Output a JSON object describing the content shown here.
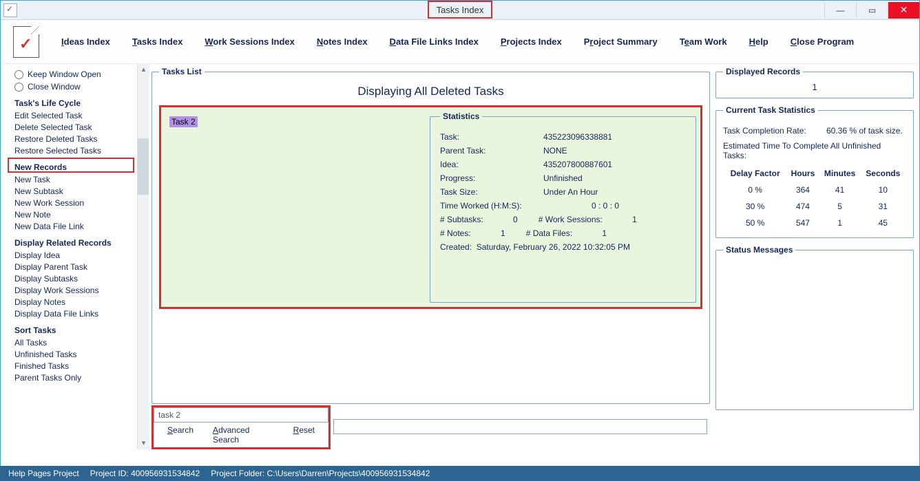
{
  "window": {
    "title": "Tasks Index"
  },
  "menu": {
    "ideas": "Ideas Index",
    "tasks": "Tasks Index",
    "work_sessions": "Work Sessions Index",
    "notes": "Notes Index",
    "data_links": "Data File Links Index",
    "projects": "Projects Index",
    "project_summary": "Project Summary",
    "team": "Team Work",
    "help": "Help",
    "close": "Close Program"
  },
  "sidebar": {
    "keep_open": "Keep Window Open",
    "close_window": "Close Window",
    "life_head": "Task's Life Cycle",
    "life": [
      "Edit Selected Task",
      "Delete Selected Task",
      "Restore Deleted Tasks",
      "Restore Selected Tasks"
    ],
    "new_head": "New Records",
    "new_items": [
      "New Task",
      "New Subtask",
      "New Work Session",
      "New Note",
      "New Data File Link"
    ],
    "disp_head": "Display Related Records",
    "disp_items": [
      "Display Idea",
      "Display Parent Task",
      "Display Subtasks",
      "Display Work Sessions",
      "Display Notes",
      "Display Data File Links"
    ],
    "sort_head": "Sort Tasks",
    "sort_items": [
      "All Tasks",
      "Unfinished Tasks",
      "Finished Tasks",
      "Parent Tasks Only"
    ]
  },
  "tasks_list": {
    "legend": "Tasks List",
    "title": "Displaying All Deleted Tasks",
    "selected": "Task 2",
    "stats_legend": "Statistics",
    "stats": {
      "task_lbl": "Task:",
      "task_val": "435223096338881",
      "parent_lbl": "Parent Task:",
      "parent_val": "NONE",
      "idea_lbl": "Idea:",
      "idea_val": "435207800887601",
      "progress_lbl": "Progress:",
      "progress_val": "Unfinished",
      "size_lbl": "Task Size:",
      "size_val": "Under An Hour",
      "time_lbl": "Time Worked (H:M:S):",
      "time_val": "0  :  0  :  0",
      "sub_lbl": "# Subtasks:",
      "sub_val": "0",
      "ws_lbl": "# Work Sessions:",
      "ws_val": "1",
      "notes_lbl": "# Notes:",
      "notes_val": "1",
      "df_lbl": "# Data Files:",
      "df_val": "1",
      "created_lbl": "Created:",
      "created_val": "Saturday, February 26, 2022   10:32:05 PM"
    }
  },
  "displayed": {
    "legend": "Displayed Records",
    "count": "1"
  },
  "cts": {
    "legend": "Current Task Statistics",
    "rate_lbl": "Task Completion Rate:",
    "rate_val": "60.36 % of task size.",
    "est_lbl": "Estimated Time To Complete All Unfinished Tasks:",
    "head": {
      "delay": "Delay Factor",
      "hours": "Hours",
      "min": "Minutes",
      "sec": "Seconds"
    },
    "rows": [
      {
        "d": "0 %",
        "h": "364",
        "m": "41",
        "s": "10"
      },
      {
        "d": "30 %",
        "h": "474",
        "m": "5",
        "s": "31"
      },
      {
        "d": "50 %",
        "h": "547",
        "m": "1",
        "s": "45"
      }
    ]
  },
  "status_msgs": {
    "legend": "Status Messages"
  },
  "search": {
    "value": "task 2",
    "search": "Search",
    "advanced": "Advanced Search",
    "reset": "Reset"
  },
  "statusbar": {
    "help": "Help Pages Project",
    "pid": "Project ID: 400956931534842",
    "folder": "Project Folder: C:\\Users\\Darren\\Projects\\400956931534842"
  }
}
